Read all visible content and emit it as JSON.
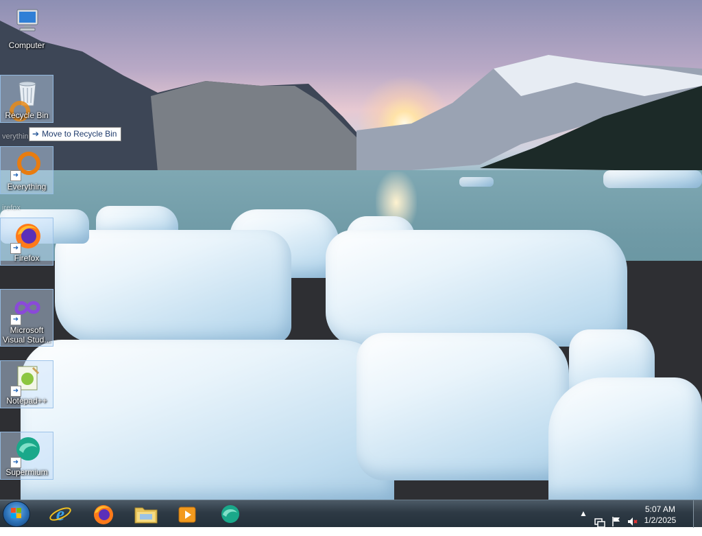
{
  "desktop": {
    "icons": [
      {
        "label": "Computer"
      },
      {
        "label": "Recycle Bin"
      },
      {
        "label": "Everything"
      },
      {
        "label": "Firefox"
      },
      {
        "label": "Microsoft Visual Stud..."
      },
      {
        "label": "Notepad++"
      },
      {
        "label": "Supermium"
      }
    ],
    "tooltip": {
      "text": "Move to Recycle Bin",
      "icon": "arrow-right-icon"
    },
    "drag_ghost_labels": [
      "verything",
      "irefox"
    ]
  },
  "taskbar": {
    "pinned": [
      {
        "name": "internet-explorer"
      },
      {
        "name": "firefox"
      },
      {
        "name": "file-explorer"
      },
      {
        "name": "windows-media-player"
      },
      {
        "name": "supermium"
      }
    ],
    "clock": {
      "time": "5:07 AM",
      "date": "1/2/2025"
    }
  },
  "colors": {
    "taskbar": "#2e3a45",
    "tooltip_border": "#767676"
  }
}
